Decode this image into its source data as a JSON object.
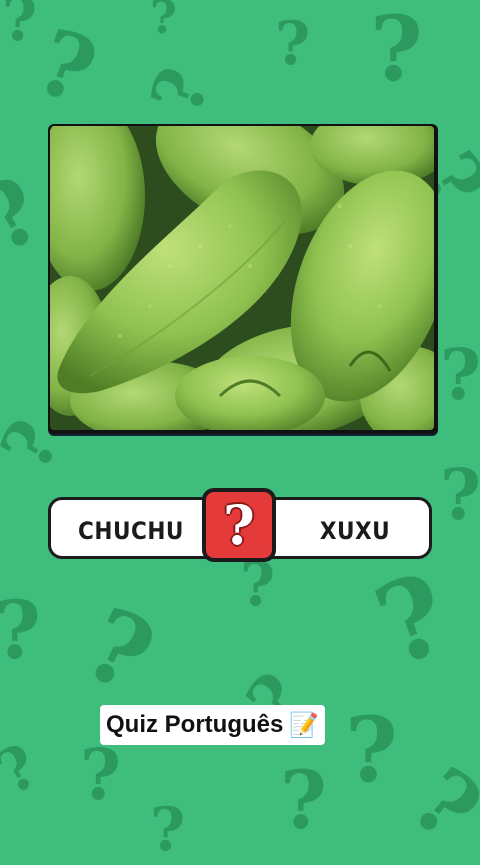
{
  "question_card": {
    "image_description_icon": "chayote-photo",
    "options": {
      "left_label": "CHUCHU",
      "right_label": "XUXU",
      "center_icon": "question-mark-icon",
      "center_symbol": "?"
    }
  },
  "caption": {
    "text": "Quiz Português",
    "emoji": "📝"
  },
  "colors": {
    "background": "#3fbd7c",
    "pattern": "#2c9a5f",
    "question_box": "#e53a3a"
  }
}
